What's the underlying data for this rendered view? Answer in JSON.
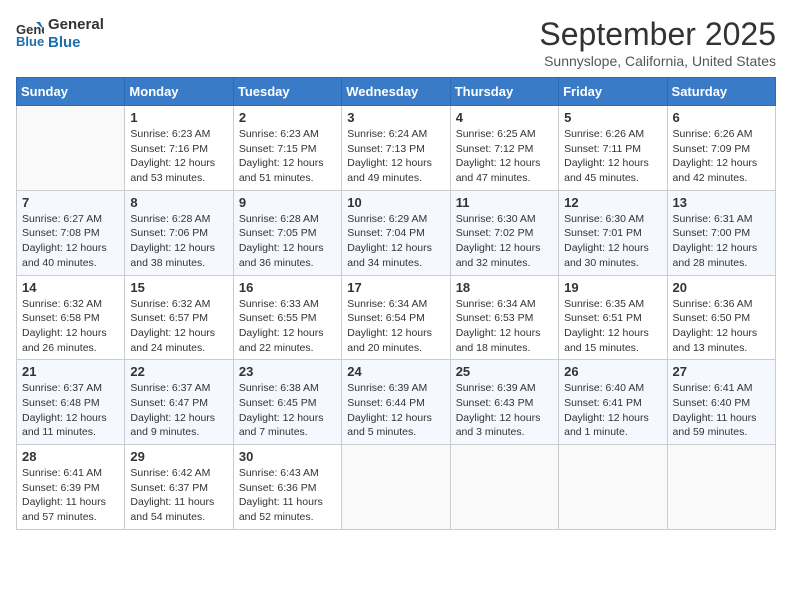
{
  "header": {
    "logo_line1": "General",
    "logo_line2": "Blue",
    "month": "September 2025",
    "location": "Sunnyslope, California, United States"
  },
  "weekdays": [
    "Sunday",
    "Monday",
    "Tuesday",
    "Wednesday",
    "Thursday",
    "Friday",
    "Saturday"
  ],
  "weeks": [
    [
      {
        "day": "",
        "info": ""
      },
      {
        "day": "1",
        "info": "Sunrise: 6:23 AM\nSunset: 7:16 PM\nDaylight: 12 hours and 53 minutes."
      },
      {
        "day": "2",
        "info": "Sunrise: 6:23 AM\nSunset: 7:15 PM\nDaylight: 12 hours and 51 minutes."
      },
      {
        "day": "3",
        "info": "Sunrise: 6:24 AM\nSunset: 7:13 PM\nDaylight: 12 hours and 49 minutes."
      },
      {
        "day": "4",
        "info": "Sunrise: 6:25 AM\nSunset: 7:12 PM\nDaylight: 12 hours and 47 minutes."
      },
      {
        "day": "5",
        "info": "Sunrise: 6:26 AM\nSunset: 7:11 PM\nDaylight: 12 hours and 45 minutes."
      },
      {
        "day": "6",
        "info": "Sunrise: 6:26 AM\nSunset: 7:09 PM\nDaylight: 12 hours and 42 minutes."
      }
    ],
    [
      {
        "day": "7",
        "info": "Sunrise: 6:27 AM\nSunset: 7:08 PM\nDaylight: 12 hours and 40 minutes."
      },
      {
        "day": "8",
        "info": "Sunrise: 6:28 AM\nSunset: 7:06 PM\nDaylight: 12 hours and 38 minutes."
      },
      {
        "day": "9",
        "info": "Sunrise: 6:28 AM\nSunset: 7:05 PM\nDaylight: 12 hours and 36 minutes."
      },
      {
        "day": "10",
        "info": "Sunrise: 6:29 AM\nSunset: 7:04 PM\nDaylight: 12 hours and 34 minutes."
      },
      {
        "day": "11",
        "info": "Sunrise: 6:30 AM\nSunset: 7:02 PM\nDaylight: 12 hours and 32 minutes."
      },
      {
        "day": "12",
        "info": "Sunrise: 6:30 AM\nSunset: 7:01 PM\nDaylight: 12 hours and 30 minutes."
      },
      {
        "day": "13",
        "info": "Sunrise: 6:31 AM\nSunset: 7:00 PM\nDaylight: 12 hours and 28 minutes."
      }
    ],
    [
      {
        "day": "14",
        "info": "Sunrise: 6:32 AM\nSunset: 6:58 PM\nDaylight: 12 hours and 26 minutes."
      },
      {
        "day": "15",
        "info": "Sunrise: 6:32 AM\nSunset: 6:57 PM\nDaylight: 12 hours and 24 minutes."
      },
      {
        "day": "16",
        "info": "Sunrise: 6:33 AM\nSunset: 6:55 PM\nDaylight: 12 hours and 22 minutes."
      },
      {
        "day": "17",
        "info": "Sunrise: 6:34 AM\nSunset: 6:54 PM\nDaylight: 12 hours and 20 minutes."
      },
      {
        "day": "18",
        "info": "Sunrise: 6:34 AM\nSunset: 6:53 PM\nDaylight: 12 hours and 18 minutes."
      },
      {
        "day": "19",
        "info": "Sunrise: 6:35 AM\nSunset: 6:51 PM\nDaylight: 12 hours and 15 minutes."
      },
      {
        "day": "20",
        "info": "Sunrise: 6:36 AM\nSunset: 6:50 PM\nDaylight: 12 hours and 13 minutes."
      }
    ],
    [
      {
        "day": "21",
        "info": "Sunrise: 6:37 AM\nSunset: 6:48 PM\nDaylight: 12 hours and 11 minutes."
      },
      {
        "day": "22",
        "info": "Sunrise: 6:37 AM\nSunset: 6:47 PM\nDaylight: 12 hours and 9 minutes."
      },
      {
        "day": "23",
        "info": "Sunrise: 6:38 AM\nSunset: 6:45 PM\nDaylight: 12 hours and 7 minutes."
      },
      {
        "day": "24",
        "info": "Sunrise: 6:39 AM\nSunset: 6:44 PM\nDaylight: 12 hours and 5 minutes."
      },
      {
        "day": "25",
        "info": "Sunrise: 6:39 AM\nSunset: 6:43 PM\nDaylight: 12 hours and 3 minutes."
      },
      {
        "day": "26",
        "info": "Sunrise: 6:40 AM\nSunset: 6:41 PM\nDaylight: 12 hours and 1 minute."
      },
      {
        "day": "27",
        "info": "Sunrise: 6:41 AM\nSunset: 6:40 PM\nDaylight: 11 hours and 59 minutes."
      }
    ],
    [
      {
        "day": "28",
        "info": "Sunrise: 6:41 AM\nSunset: 6:39 PM\nDaylight: 11 hours and 57 minutes."
      },
      {
        "day": "29",
        "info": "Sunrise: 6:42 AM\nSunset: 6:37 PM\nDaylight: 11 hours and 54 minutes."
      },
      {
        "day": "30",
        "info": "Sunrise: 6:43 AM\nSunset: 6:36 PM\nDaylight: 11 hours and 52 minutes."
      },
      {
        "day": "",
        "info": ""
      },
      {
        "day": "",
        "info": ""
      },
      {
        "day": "",
        "info": ""
      },
      {
        "day": "",
        "info": ""
      }
    ]
  ]
}
